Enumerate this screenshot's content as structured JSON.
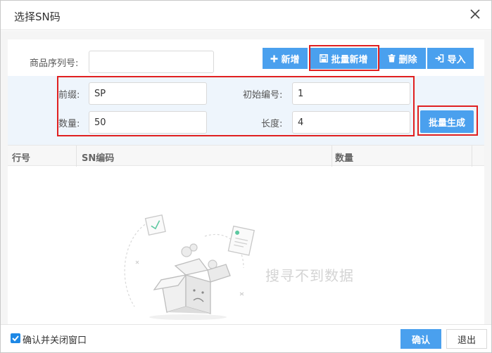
{
  "dialog": {
    "title": "选择SN码"
  },
  "form": {
    "serial_label": "商品序列号:",
    "serial_value": "",
    "prefix_label": "前缀:",
    "prefix_value": "SP",
    "start_label": "初始编号:",
    "start_value": "1",
    "count_label": "数量:",
    "count_value": "50",
    "length_label": "长度:",
    "length_value": "4"
  },
  "toolbar": {
    "add_label": "新增",
    "batch_add_label": "批量新增",
    "delete_label": "删除",
    "import_label": "导入",
    "batch_generate_label": "批量生成"
  },
  "grid": {
    "columns": [
      "行号",
      "SN编码",
      "数量"
    ],
    "rows": [],
    "empty_text": "搜寻不到数据"
  },
  "footer": {
    "confirm_close_label": "确认并关闭窗口",
    "confirm_close_checked": true,
    "ok_label": "确认",
    "exit_label": "退出"
  },
  "colors": {
    "primary": "#4aa0ee",
    "highlight": "#e02020",
    "panel": "#eef5fc"
  }
}
